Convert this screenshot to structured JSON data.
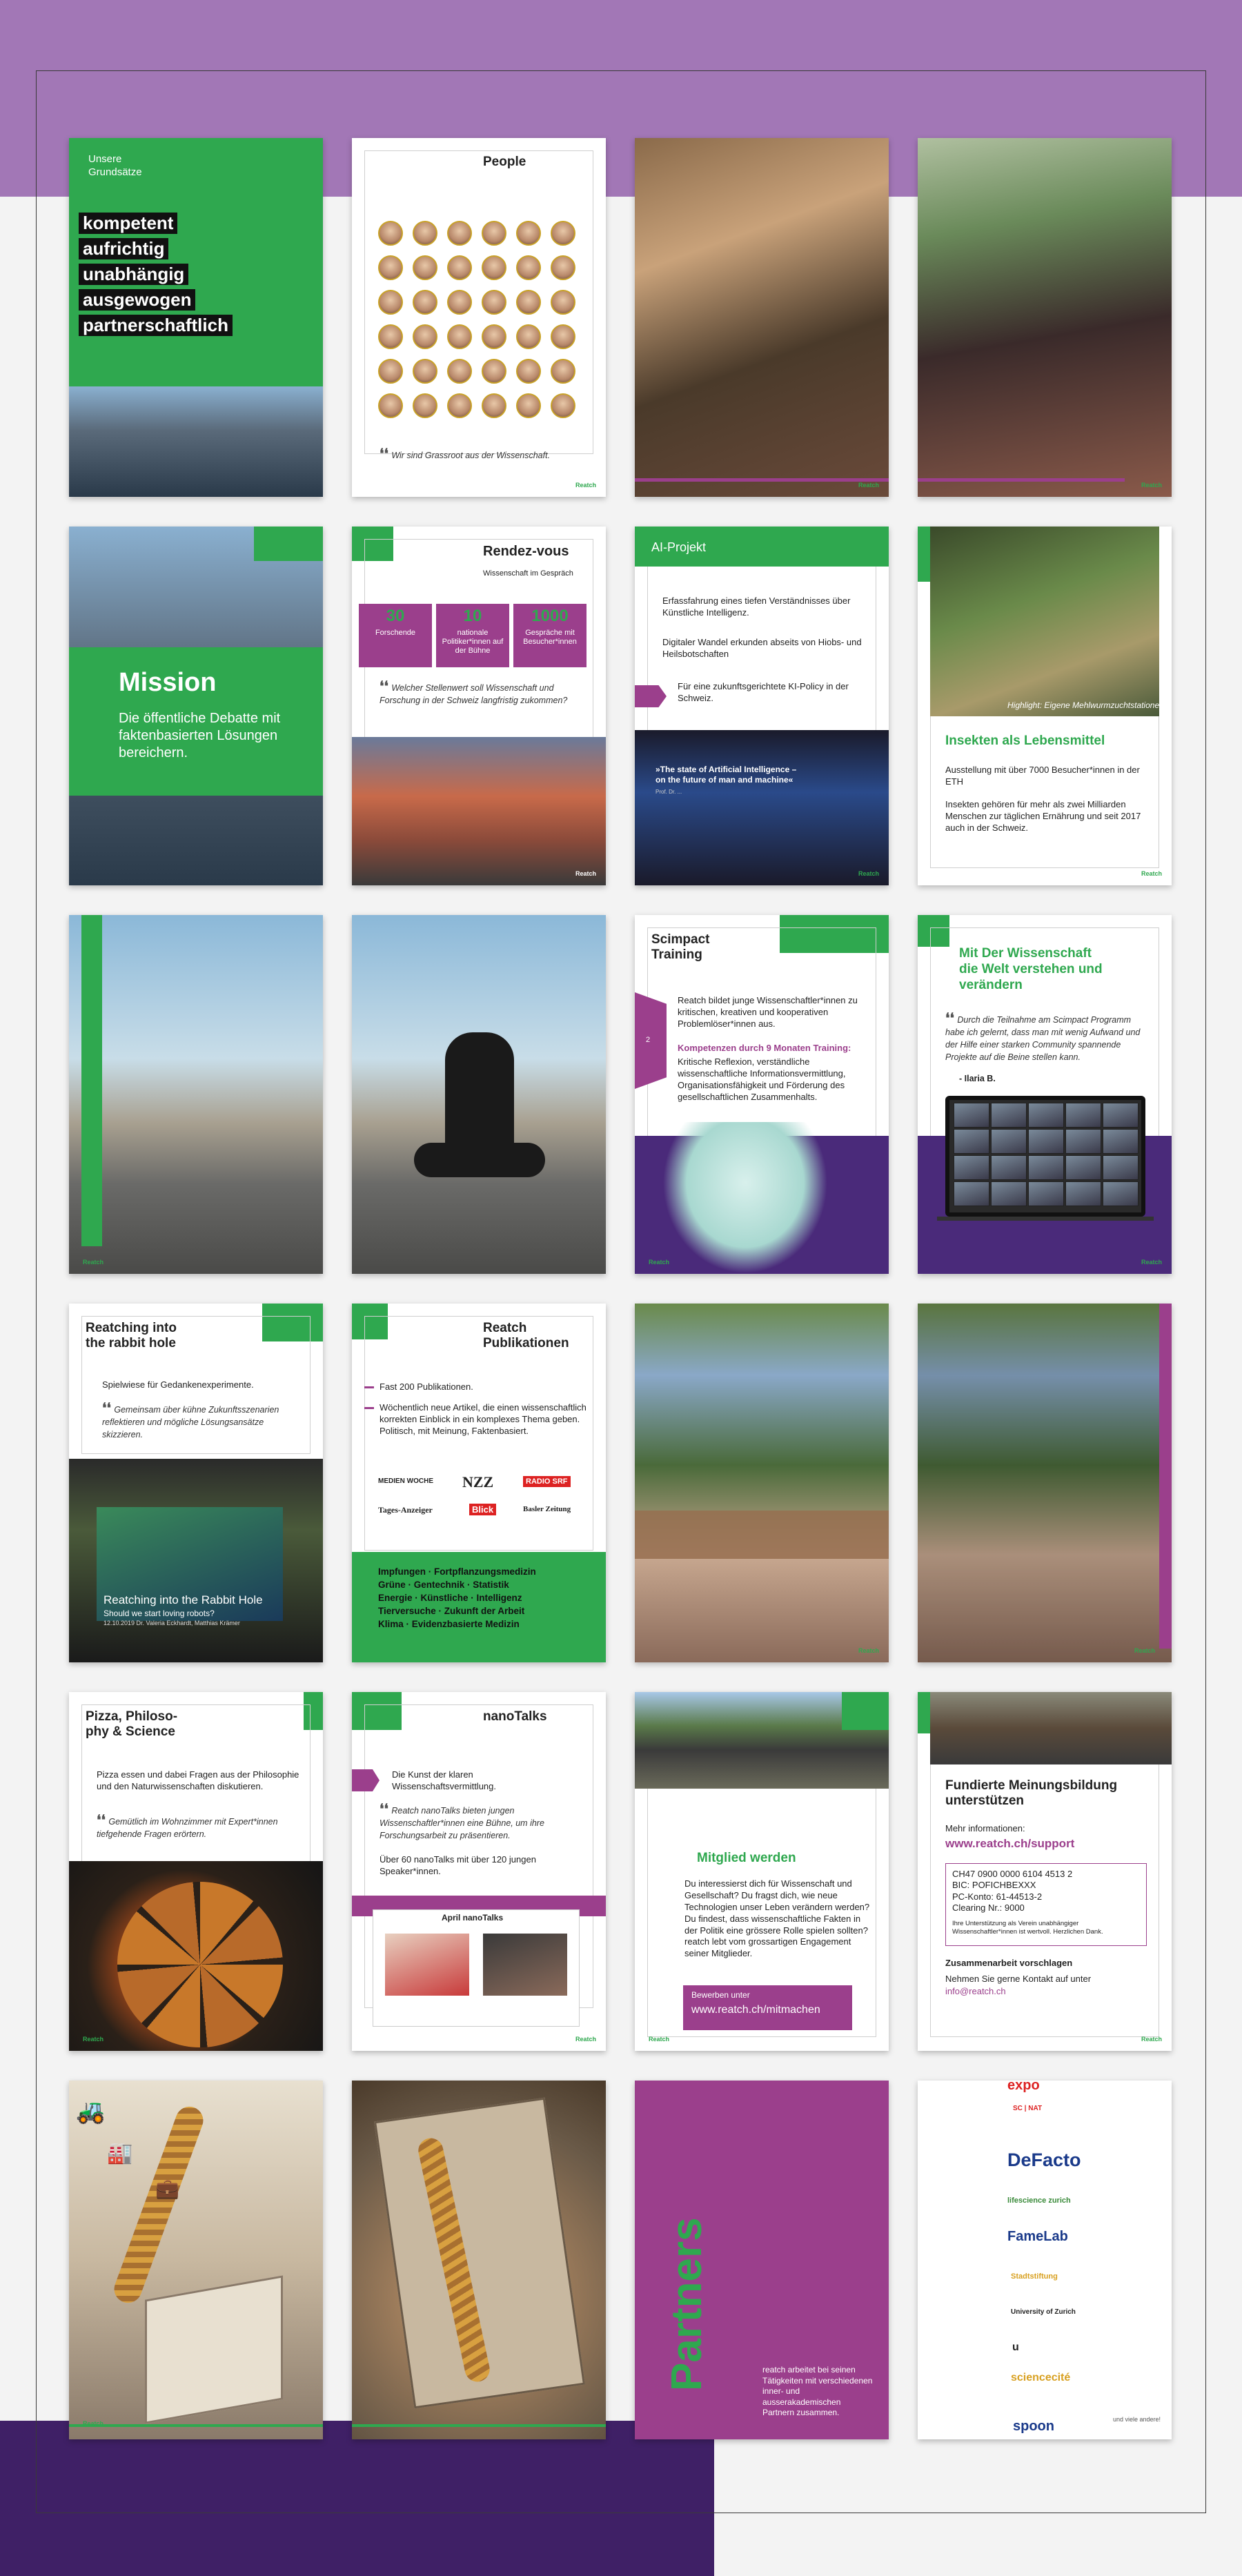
{
  "colors": {
    "green": "#2fa84f",
    "purple": "#9b3f8c",
    "dark_purple": "#4a2a7a",
    "background_top": "#a277b6"
  },
  "brand": "Reatch",
  "cards": {
    "c1": {
      "eyebrow": "Unsere\nGrundsätze",
      "values": [
        "kompetent",
        "aufrichtig",
        "unabhängig",
        "ausgewogen",
        "partnerschaftlich"
      ]
    },
    "c2": {
      "title": "People",
      "quote": "Wir sind Grassroot aus der Wissenschaft."
    },
    "c5": {
      "title": "Mission",
      "text": "Die öffentliche Debatte mit faktenbasierten Lösungen bereichern."
    },
    "c6": {
      "title": "Rendez-vous",
      "subtitle": "Wissenschaft im Gespräch",
      "stats": [
        {
          "num": "30",
          "label": "Forschende"
        },
        {
          "num": "10",
          "label": "nationale Politiker*innen auf der Bühne"
        },
        {
          "num": "1000",
          "label": "Gespräche mit Besucher*innen"
        }
      ],
      "quote": "Welcher Stellenwert soll Wissenschaft und Forschung in der Schweiz langfristig zukommen?"
    },
    "c7": {
      "title": "AI-Projekt",
      "p1": "Erfassfahrung eines tiefen Verständnisses über Künstliche Intelligenz.",
      "p2": "Digitaler Wandel erkunden abseits von Hiobs- und Heilsbotschaften",
      "p3": "Für eine zukunftsgerichtete KI-Policy in der Schweiz.",
      "slide": "»The state of Artificial Intelligence – on the future of man and machine«",
      "slide_sub": "Prof. Dr. ..."
    },
    "c8": {
      "caption": "Highlight: Eigene Mehlwurmzuchtstationen",
      "title": "Insekten als Lebensmittel",
      "p1": "Ausstellung mit über 7000 Besucher*innen in der ETH",
      "p2": "Insekten gehören für mehr als zwei Milliarden Menschen zur täglichen Ernährung und seit 2017 auch in der Schweiz."
    },
    "c11": {
      "title": "Scimpact\nTraining",
      "side_tag": "2",
      "p1": "Reatch bildet junge Wissenschaftler*innen zu kritischen, kreativen und kooperativen Problemlöser*innen aus.",
      "highlight": "Kompetenzen durch 9 Monaten Training:",
      "p2": "Kritische Reflexion, verständliche wissenschaftliche Informationsvermittlung, Organisationsfähigkeit und Förderung des gesellschaftlichen Zusammenhalts."
    },
    "c12": {
      "title": "Mit Der Wissenschaft\ndie Welt verstehen und\nverändern",
      "quote": "Durch die Teilnahme am Scimpact Programm habe ich gelernt, dass man mit wenig Aufwand und der Hilfe einer starken Community spannende Projekte auf die Beine stellen kann.",
      "author": "- Ilaria B."
    },
    "c13": {
      "title": "Reatching into\nthe rabbit hole",
      "p1": "Spielwiese für Gedankenexperimente.",
      "quote": "Gemeinsam über kühne Zukunftsszenarien reflektieren und mögliche Lösungsansätze skizzieren.",
      "screen_title": "Reatching into the Rabbit Hole",
      "screen_sub": "Should we start loving robots?",
      "screen_date": "12.10.2019  Dr. Valeria Eckhardt, Matthias Krämer"
    },
    "c14": {
      "title": "Reatch\nPublikationen",
      "b1": "Fast 200 Publikationen.",
      "b2": "Wöchentlich neue Artikel, die einen wissenschaftlich korrekten Einblick in ein komplexes Thema geben. Politisch, mit Meinung, Faktenbasiert.",
      "media": [
        "MEDIEN WOCHE",
        "NZZ",
        "RADIO SRF",
        "Tages-Anzeiger",
        "Blick",
        "Basler Zeitung"
      ],
      "topics": "Impfungen · Fortpflanzungsmedizin\nGrüne · Gentechnik · Statistik\nEnergie · Künstliche · Intelligenz\nTierversuche · Zukunft der Arbeit\nKlima · Evidenzbasierte Medizin"
    },
    "c17": {
      "title": "Pizza, Philoso-\nphy & Science",
      "p1": "Pizza essen und dabei Fragen aus der Philosophie und den Naturwissenschaften diskutieren.",
      "quote": "Gemütlich im Wohnzimmer mit Expert*innen tiefgehende Fragen erörtern."
    },
    "c18": {
      "title": "nanoTalks",
      "p1": "Die Kunst der klaren Wissenschaftsvermittlung.",
      "quote": "Reatch nanoTalks bieten jungen Wissenschaftler*innen eine Bühne, um ihre Forschungsarbeit zu präsentieren.",
      "p2": "Über 60 nanoTalks mit über 120 jungen Speaker*innen.",
      "event": "April nanoTalks"
    },
    "c19": {
      "title": "Mitglied werden",
      "p1": "Du interessierst dich für Wissenschaft und Gesellschaft? Du fragst dich, wie neue Technologien unser Leben verändern werden? Du findest, dass wissenschaftliche Fakten in der Politik eine grössere Rolle spielen sollten? reatch lebt vom grossartigen Engagement seiner Mitglieder.",
      "cta_label": "Bewerben unter",
      "cta_link": "www.reatch.ch/mitmachen"
    },
    "c20": {
      "title": "Fundierte Meinungsbildung\nunterstützen",
      "info": "Mehr informationen:",
      "link": "www.reatch.ch/support",
      "bank": "CH47 0900 0000 6104 4513 2\nBIC: POFICHBEXXX\nPC-Konto: 61-44513-2\nClearing Nr.: 9000",
      "thanks": "Ihre Unterstützung als Verein unabhängiger Wissenschaftler*innen ist wertvoll. Herzlichen Dank.",
      "collab": "Zusammenarbeit vorschlagen",
      "contact": "Nehmen Sie gerne Kontakt auf unter",
      "email": "info@reatch.ch"
    },
    "c23": {
      "title": "Partners",
      "text": "reatch arbeitet bei seinen Tätigkeiten mit verschiedenen inner- und ausserakademischen Partnern zusammen."
    },
    "c24": {
      "logos": [
        "expo",
        "SC | NAT",
        "DeFacto",
        "lifescience zurich",
        "FameLab",
        "Stadtstiftung",
        "University of Zurich",
        "u",
        "sciencecité",
        "spoon"
      ],
      "footer": "und viele andere!"
    }
  }
}
